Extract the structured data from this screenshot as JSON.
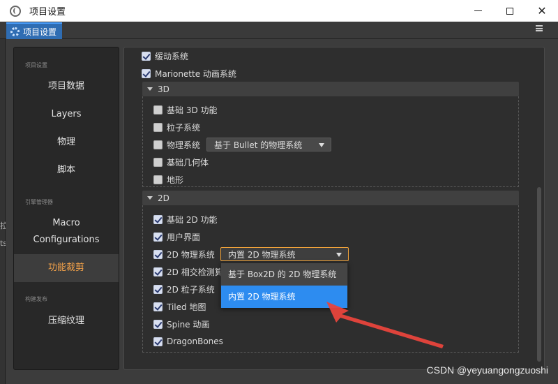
{
  "window": {
    "title": "项目设置",
    "controls": {
      "minimize": "",
      "maximize": "",
      "close": "✕"
    }
  },
  "tab": {
    "label": "项目设置"
  },
  "left_fragments": [
    "拉",
    "ts"
  ],
  "sidebar": {
    "section_project": "项目设置",
    "items_project": [
      "项目数据",
      "Layers",
      "物理",
      "脚本"
    ],
    "section_engine": "引擎管理器",
    "macro_line1": "Macro",
    "macro_line2": "Configurations",
    "feature_crop": "功能裁剪",
    "section_build": "构建发布",
    "compress": "压缩纹理"
  },
  "main": {
    "top_items": [
      {
        "label": "缓动系统",
        "checked": true
      },
      {
        "label": "Marionette 动画系统",
        "checked": true
      }
    ],
    "section_3d": {
      "header": "3D",
      "items": [
        {
          "label": "基础 3D 功能",
          "checked": false
        },
        {
          "label": "粒子系统",
          "checked": false
        },
        {
          "label": "物理系统",
          "checked": false
        },
        {
          "label": "基础几何体",
          "checked": false
        },
        {
          "label": "地形",
          "checked": false
        }
      ],
      "physics_dropdown": "基于 Bullet 的物理系统"
    },
    "section_2d": {
      "header": "2D",
      "items": [
        {
          "label": "基础 2D 功能",
          "checked": true
        },
        {
          "label": "用户界面",
          "checked": true
        },
        {
          "label": "2D 物理系统",
          "checked": true
        },
        {
          "label": "2D 相交检测算",
          "checked": true
        },
        {
          "label": "2D 粒子系统",
          "checked": true
        },
        {
          "label": "Tiled 地图",
          "checked": true
        },
        {
          "label": "Spine 动画",
          "checked": true
        },
        {
          "label": "DragonBones",
          "checked": true
        }
      ],
      "physics_dropdown": "内置 2D 物理系统",
      "options": [
        "基于 Box2D 的 2D 物理系统",
        "内置 2D 物理系统"
      ],
      "selected_option_index": 1
    }
  },
  "watermark": "CSDN @yeyuangongzuoshi",
  "colors": {
    "accent": "#2d8cf0",
    "active_text": "#f5a34a",
    "focus_border": "#f0a23a",
    "arrow": "#e8453c"
  }
}
